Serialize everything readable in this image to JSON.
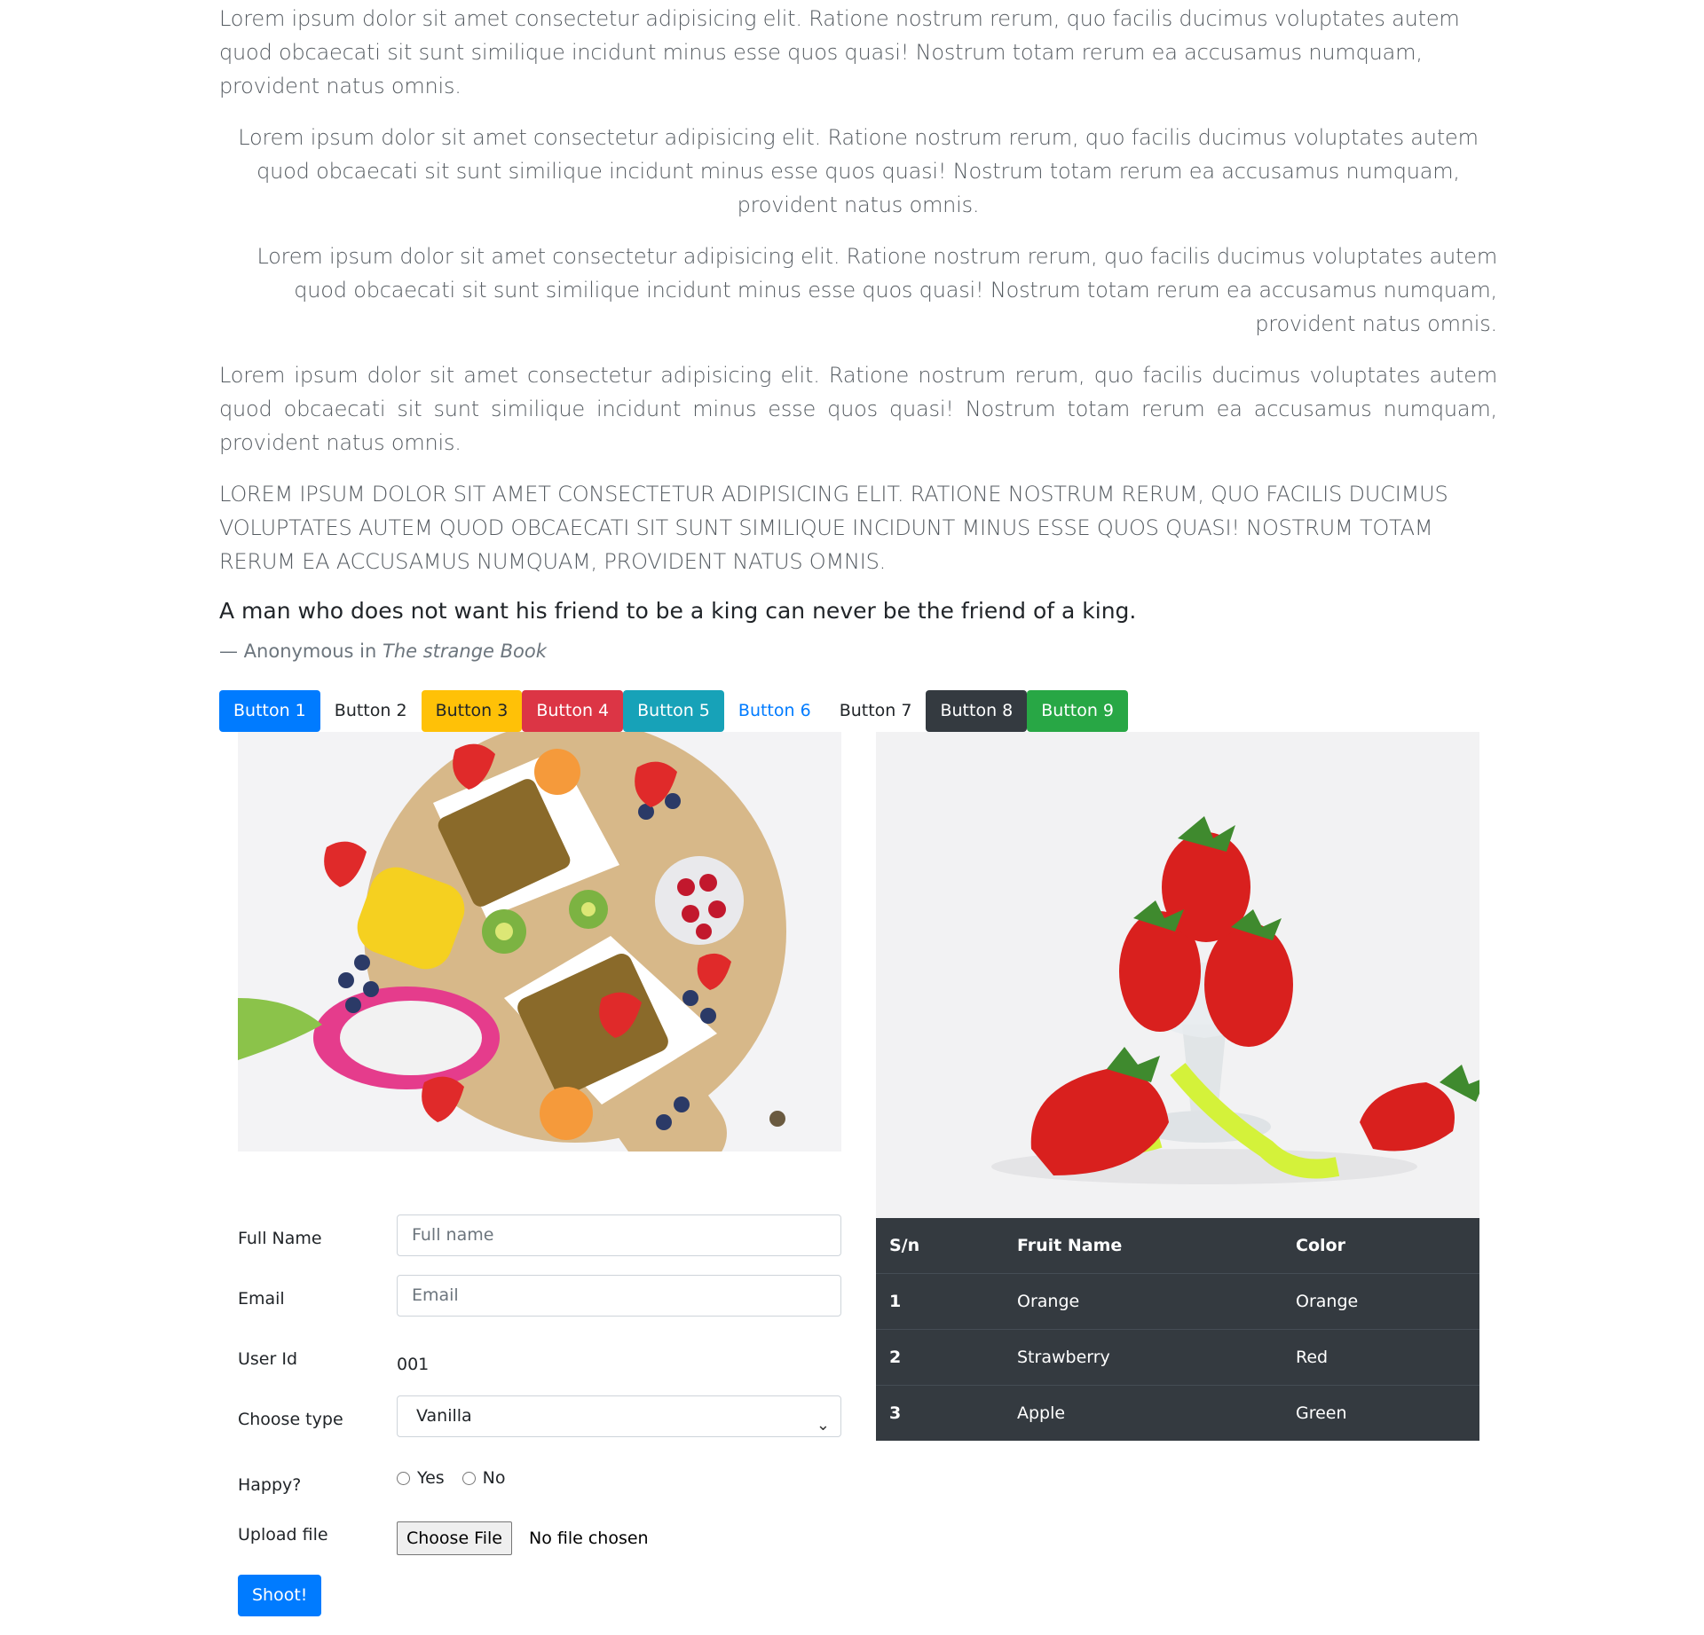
{
  "paragraphs": {
    "p1": "Lorem ipsum dolor sit amet consectetur adipisicing elit. Ratione nostrum rerum, quo facilis ducimus voluptates autem quod obcaecati sit sunt similique incidunt minus esse quos quasi! Nostrum totam rerum ea accusamus numquam, provident natus omnis.",
    "p2": "Lorem ipsum dolor sit amet consectetur adipisicing elit. Ratione nostrum rerum, quo facilis ducimus voluptates autem quod obcaecati sit sunt similique incidunt minus esse quos quasi! Nostrum totam rerum ea accusamus numquam, provident natus omnis.",
    "p3": "Lorem ipsum dolor sit amet consectetur adipisicing elit. Ratione nostrum rerum, quo facilis ducimus voluptates autem quod obcaecati sit sunt similique incidunt minus esse quos quasi! Nostrum totam rerum ea accusamus numquam, provident natus omnis.",
    "p4": "Lorem ipsum dolor sit amet consectetur adipisicing elit. Ratione nostrum rerum, quo facilis ducimus voluptates autem quod obcaecati sit sunt similique incidunt minus esse quos quasi! Nostrum totam rerum ea accusamus numquam, provident natus omnis.",
    "p5": "LOREM IPSUM DOLOR SIT AMET CONSECTETUR ADIPISICING ELIT. RATIONE NOSTRUM RERUM, QUO FACILIS DUCIMUS VOLUPTATES AUTEM QUOD OBCAECATI SIT SUNT SIMILIQUE INCIDUNT MINUS ESSE QUOS QUASI! NOSTRUM TOTAM RERUM EA ACCUSAMUS NUMQUAM, PROVIDENT NATUS OMNIS."
  },
  "quote": {
    "text": "A man who does not want his friend to be a king can never be the friend of a king.",
    "author_prefix": "— Anonymous in ",
    "source": "The strange Book"
  },
  "buttons": [
    "Button 1",
    "Button 2",
    "Button 3",
    "Button 4",
    "Button 5",
    "Button 6",
    "Button 7",
    "Button 8",
    "Button 9"
  ],
  "colors": {
    "primary": "#007bff",
    "warning": "#ffc107",
    "danger": "#dc3545",
    "info": "#17a2b8",
    "dark": "#343a40",
    "success": "#28a745"
  },
  "form": {
    "full_name_label": "Full Name",
    "full_name_placeholder": "Full name",
    "email_label": "Email",
    "email_placeholder": "Email",
    "user_id_label": "User Id",
    "user_id_value": "001",
    "type_label": "Choose type",
    "type_value": "Vanilla",
    "happy_label": "Happy?",
    "happy_yes": "Yes",
    "happy_no": "No",
    "upload_label": "Upload file",
    "upload_button": "Choose File",
    "upload_status": "No file chosen",
    "submit": "Shoot!"
  },
  "table": {
    "headers": [
      "S/n",
      "Fruit Name",
      "Color"
    ],
    "rows": [
      [
        "1",
        "Orange",
        "Orange"
      ],
      [
        "2",
        "Strawberry",
        "Red"
      ],
      [
        "3",
        "Apple",
        "Green"
      ]
    ]
  }
}
